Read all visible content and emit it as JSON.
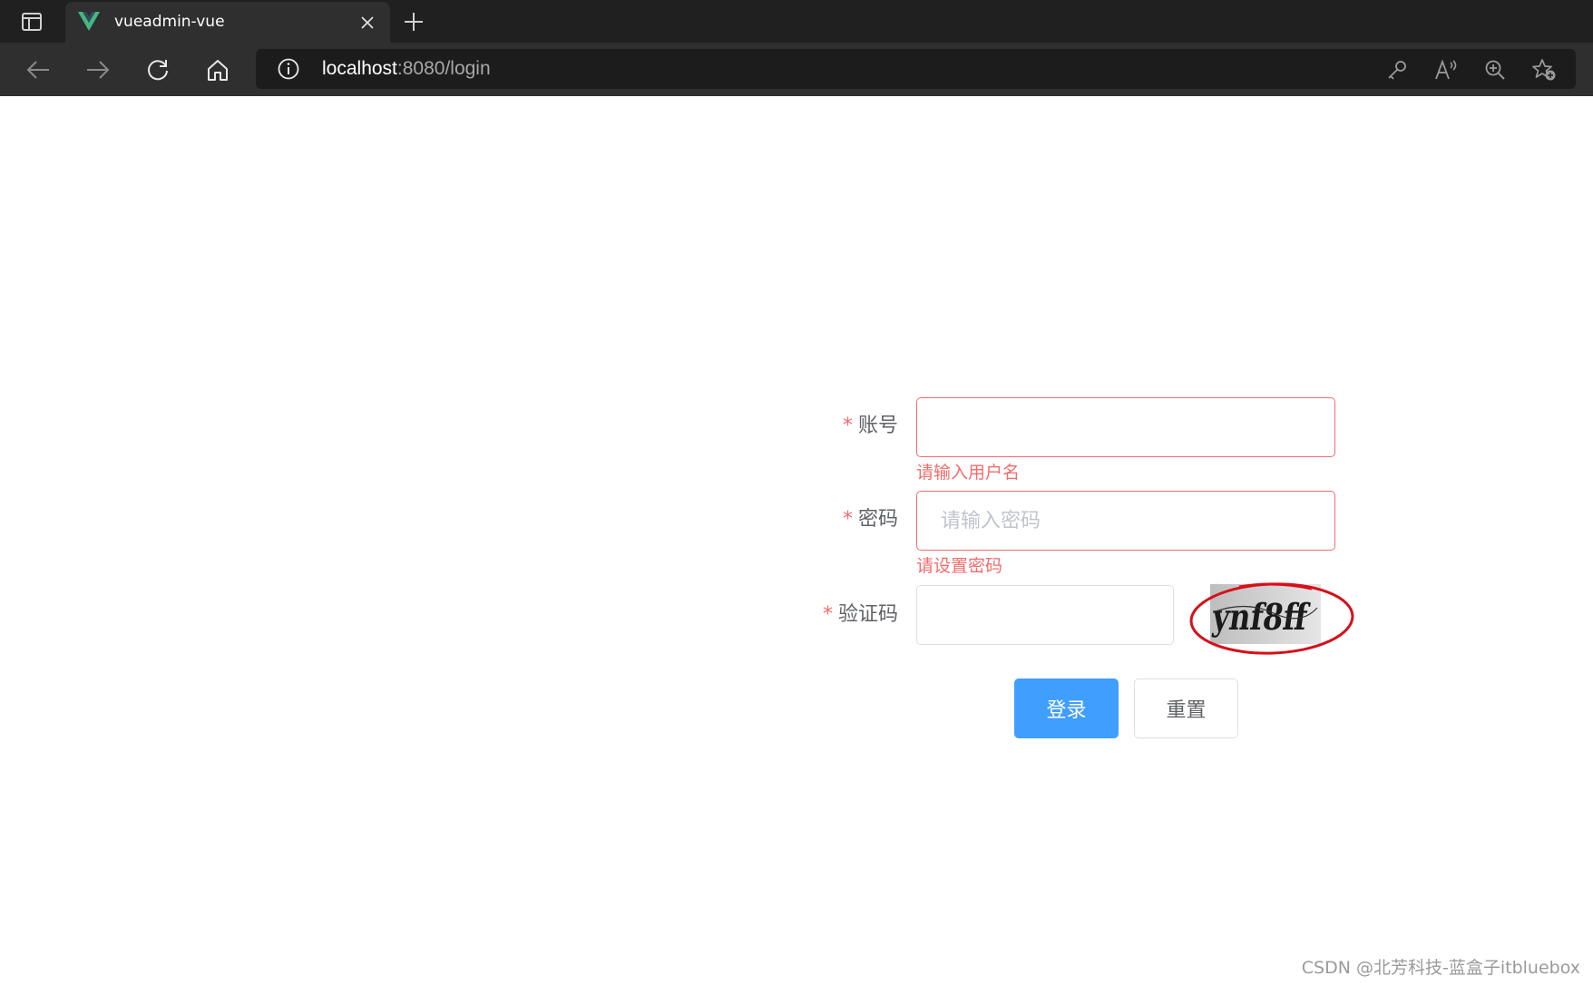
{
  "browser": {
    "tab": {
      "title": "vueadmin-vue"
    },
    "address": {
      "host": "localhost",
      "rest": ":8080/login"
    }
  },
  "form": {
    "username": {
      "label": "账号",
      "required_mark": "*",
      "value": "",
      "placeholder": "",
      "error": "请输入用户名"
    },
    "password": {
      "label": "密码",
      "required_mark": "*",
      "value": "",
      "placeholder": "请输入密码",
      "error": "请设置密码"
    },
    "captcha": {
      "label": "验证码",
      "required_mark": "*",
      "value": "",
      "placeholder": "",
      "image_text": "ynf8ff"
    },
    "login_label": "登录",
    "reset_label": "重置"
  },
  "watermark": "CSDN @北芳科技-蓝盒子itbluebox",
  "colors": {
    "primary": "#409eff",
    "error": "#f56c6c",
    "annotation": "#d6101a",
    "vue_green": "#41b883"
  }
}
